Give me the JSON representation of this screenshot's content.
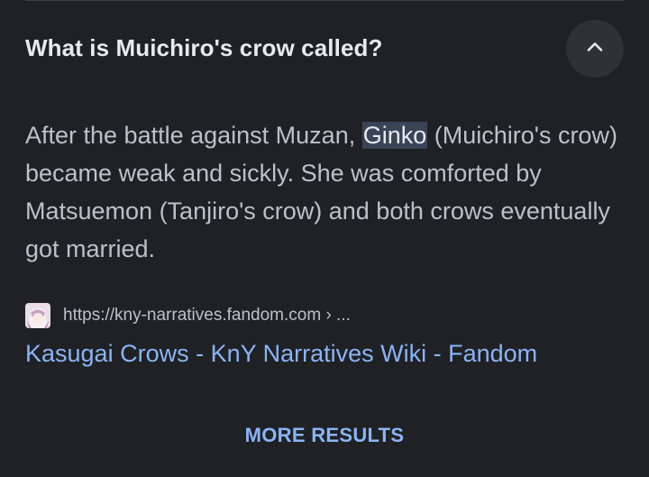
{
  "faq": {
    "question": "What is Muichiro's crow called?",
    "collapse_icon": "chevron-up-icon",
    "answer": {
      "before": "After the battle against Muzan, ",
      "highlight": "Ginko",
      "after": " (Muichiro's crow) became weak and sickly. She was comforted by Matsuemon (Tanjiro's crow) and both crows eventually got married."
    },
    "source": {
      "favicon": "site-favicon",
      "url": "https://kny-narratives.fandom.com › ...",
      "title": "Kasugai Crows - KnY Narratives Wiki - Fandom"
    }
  },
  "more_results_label": "MORE RESULTS",
  "colors": {
    "background": "#202124",
    "question": "#e8eaed",
    "body_text": "#bdc1c6",
    "link": "#8ab4f8",
    "highlight_bg": "#394457",
    "button_bg": "#303134"
  }
}
